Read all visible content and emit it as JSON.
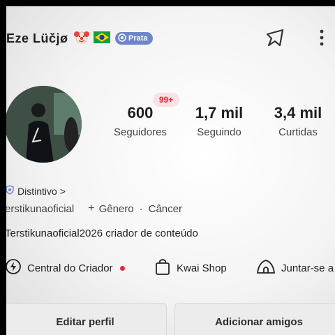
{
  "profile": {
    "username": "Eze Lüčjø",
    "tier_badge": "Prata",
    "avatar_alt": "profile photo"
  },
  "stats": {
    "notification_badge": "99+",
    "followers": {
      "value": "600",
      "label": "Seguidores"
    },
    "following": {
      "value": "1,7 mil",
      "label": "Seguindo"
    },
    "likes": {
      "value": "3,4 mil",
      "label": "Curtidas"
    }
  },
  "badge_row": {
    "label": "Distintivo",
    "chevron": ">"
  },
  "tags": {
    "handle": "erstikunaoficial",
    "add_gender": "Gênero",
    "separator": "·",
    "zodiac": "Câncer"
  },
  "bio": "Terstikunaoficial2026 criador de conteúdo",
  "shortcuts": [
    {
      "label": "Central do Criador",
      "icon": "bolt-icon"
    },
    {
      "label": "Kwai Shop",
      "icon": "shopping-bag-icon"
    },
    {
      "label": "Juntar-se a",
      "icon": "tent-icon"
    }
  ],
  "buttons": {
    "edit_profile": "Editar perfil",
    "add_friends": "Adicionar amigos"
  },
  "colors": {
    "tier_badge": "#6d86c9",
    "notification": "#e3263a",
    "notification_bg": "#fbe1e3"
  }
}
